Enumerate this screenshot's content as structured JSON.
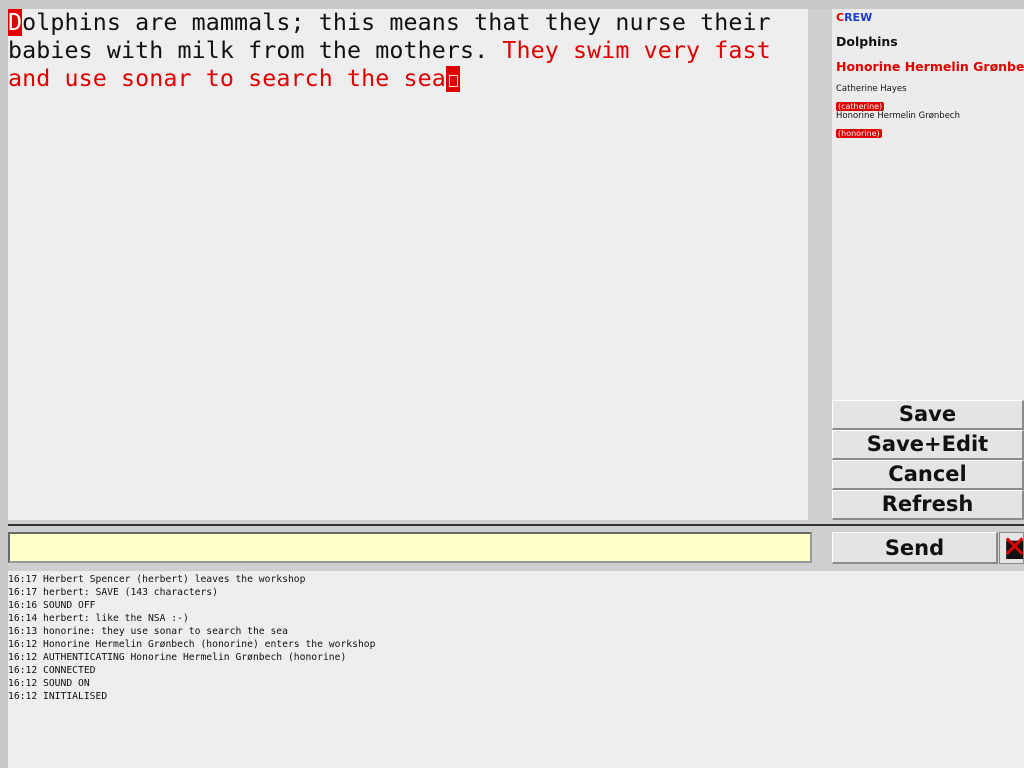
{
  "editor": {
    "first_letter": "D",
    "black_text": "olphins are mammals; this means that they nurse their\nbabies with milk from the mothers. ",
    "red_text": "They swim very fast\nand use sonar to search the sea"
  },
  "crew": {
    "title_c": "C",
    "title_rest": "REW",
    "topic": "Dolphins",
    "current_user": "Honorine Hermelin Grønbech",
    "members": [
      {
        "name": "Catherine Hayes",
        "tag": "(catherine)"
      },
      {
        "name": "Honorine Hermelin Grønbech",
        "tag": "(honorine)"
      }
    ]
  },
  "buttons": {
    "save": "Save",
    "save_edit": "Save+Edit",
    "cancel": "Cancel",
    "refresh": "Refresh",
    "send": "Send"
  },
  "chat_input": {
    "value": "",
    "placeholder": ""
  },
  "close_icon": "close-icon",
  "colors": {
    "accent_red": "#e00000",
    "accent_blue": "#1a3ccf",
    "input_bg": "#ffffcc"
  },
  "log": [
    "16:17 Herbert Spencer (herbert) leaves the workshop",
    "16:17 herbert: SAVE (143 characters)",
    "16:16 SOUND OFF",
    "16:14 herbert: like the NSA :-)",
    "16:13 honorine: they use sonar to search the sea",
    "16:12 Honorine Hermelin Grønbech (honorine) enters the workshop",
    "16:12 AUTHENTICATING Honorine Hermelin Grønbech (honorine)",
    "16:12 CONNECTED",
    "16:12 SOUND ON",
    "16:12 INITIALISED"
  ]
}
